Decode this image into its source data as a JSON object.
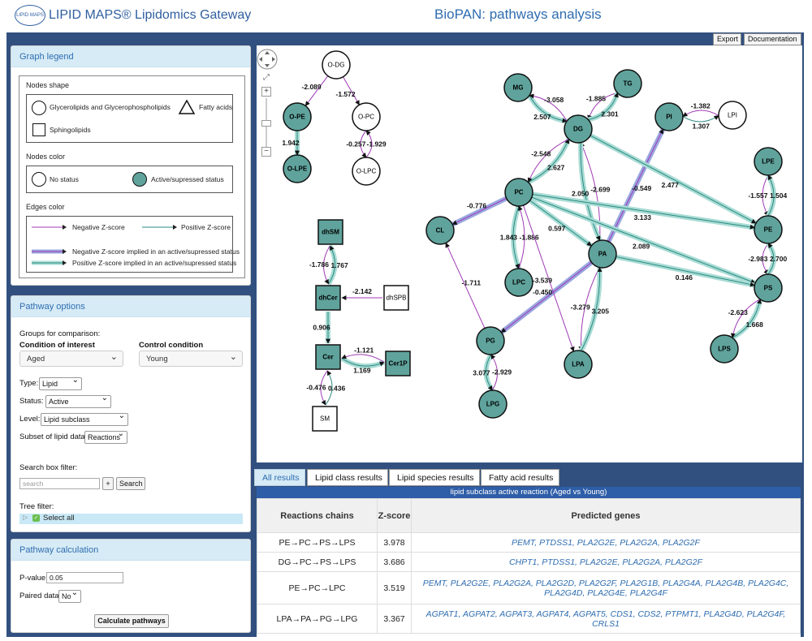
{
  "header": {
    "logo_text": "LIPID MAPS",
    "site_title": "LIPID MAPS® Lipidomics Gateway",
    "app_title": "BioPAN: pathways analysis"
  },
  "toolbar": {
    "export_label": "Export",
    "documentation_label": "Documentation"
  },
  "legend": {
    "title": "Graph legend",
    "shape_title": "Nodes shape",
    "shape_items": [
      "Glycerolipids and Glycerophospholipids",
      "Fatty acids",
      "Sphingolipids"
    ],
    "color_title": "Nodes color",
    "color_items": [
      "No status",
      "Active/supressed status"
    ],
    "edge_title": "Edges color",
    "edge_items": [
      "Negative Z-score",
      "Positive Z-score",
      "Negative Z-score implied in an active/supressed status",
      "Positive Z-score implied in an active/supressed status"
    ]
  },
  "options": {
    "title": "Pathway options",
    "groups_label": "Groups for comparison:",
    "condition_label": "Condition of interest",
    "control_label": "Control condition",
    "condition_value": "Aged",
    "control_value": "Young",
    "type_label": "Type:",
    "type_value": "Lipid",
    "status_label": "Status:",
    "status_value": "Active",
    "level_label": "Level:",
    "level_value": "Lipid subclass",
    "subset_label": "Subset of lipid data:",
    "subset_value": "Reactions",
    "search_label": "Search box filter:",
    "search_placeholder": "search",
    "plus_label": "+",
    "search_button": "Search",
    "tree_label": "Tree filter:",
    "select_all": "Select all"
  },
  "calc": {
    "title": "Pathway calculation",
    "pvalue_label": "P-value:",
    "pvalue_value": "0.05",
    "paired_label": "Paired data:",
    "paired_value": "No",
    "calc_button": "Calculate pathways"
  },
  "graph_controls": {
    "zoom_in": "+",
    "zoom_out": "−",
    "fit": "⤢"
  },
  "graph": {
    "colors": {
      "teal": "#5fa39c",
      "neg": "#a03ab5",
      "pos": "#2a8a80",
      "neg_halo": "#9aa8e0",
      "pos_halo": "#a9dcd5"
    },
    "nodes": [
      {
        "id": "O-DG",
        "shape": "circle",
        "active": false
      },
      {
        "id": "O-PE",
        "shape": "circle",
        "active": true
      },
      {
        "id": "O-PC",
        "shape": "circle",
        "active": false
      },
      {
        "id": "O-LPE",
        "shape": "circle",
        "active": true
      },
      {
        "id": "O-LPC",
        "shape": "circle",
        "active": false
      },
      {
        "id": "MG",
        "shape": "circle",
        "active": true
      },
      {
        "id": "TG",
        "shape": "circle",
        "active": true
      },
      {
        "id": "DG",
        "shape": "circle",
        "active": true
      },
      {
        "id": "PI",
        "shape": "circle",
        "active": true
      },
      {
        "id": "LPI",
        "shape": "circle",
        "active": false
      },
      {
        "id": "LPE",
        "shape": "circle",
        "active": true
      },
      {
        "id": "PC",
        "shape": "circle",
        "active": true
      },
      {
        "id": "CL",
        "shape": "circle",
        "active": true
      },
      {
        "id": "PE",
        "shape": "circle",
        "active": true
      },
      {
        "id": "PA",
        "shape": "circle",
        "active": true
      },
      {
        "id": "PS",
        "shape": "circle",
        "active": true
      },
      {
        "id": "LPC",
        "shape": "circle",
        "active": true
      },
      {
        "id": "LPS",
        "shape": "circle",
        "active": true
      },
      {
        "id": "PG",
        "shape": "circle",
        "active": true
      },
      {
        "id": "LPA",
        "shape": "circle",
        "active": true
      },
      {
        "id": "PGs",
        "label": "PG",
        "shape": "circle",
        "active": true
      },
      {
        "id": "LPG",
        "shape": "circle",
        "active": true
      },
      {
        "id": "dhSM",
        "shape": "square",
        "active": true
      },
      {
        "id": "dhCer",
        "shape": "square",
        "active": true
      },
      {
        "id": "dhSPB",
        "shape": "square",
        "active": false
      },
      {
        "id": "Cer",
        "shape": "square",
        "active": true
      },
      {
        "id": "Cer1P",
        "shape": "square",
        "active": true
      },
      {
        "id": "SM",
        "shape": "square",
        "active": false
      }
    ],
    "edges": [
      {
        "from": "O-DG",
        "to": "O-PE",
        "z": "-2.089",
        "kind": "neg"
      },
      {
        "from": "O-DG",
        "to": "O-PC",
        "z": "-1.572",
        "kind": "neg"
      },
      {
        "from": "O-PE",
        "to": "O-LPE",
        "z": "1.942",
        "kind": "pos_active"
      },
      {
        "from": "O-PC",
        "to": "O-LPC",
        "z": "-0.257",
        "kind": "neg",
        "curve": -1
      },
      {
        "from": "O-LPC",
        "to": "O-PC",
        "z": "-1.929",
        "kind": "neg",
        "curve": -1
      },
      {
        "from": "MG",
        "to": "DG",
        "z": "2.507",
        "kind": "pos_active",
        "curve": -1
      },
      {
        "from": "DG",
        "to": "MG",
        "z": "-3.058",
        "kind": "neg",
        "curve": -1
      },
      {
        "from": "TG",
        "to": "DG",
        "z": "-1.885",
        "kind": "neg",
        "curve": -1
      },
      {
        "from": "DG",
        "to": "TG",
        "z": "2.301",
        "kind": "pos_active",
        "curve": -1
      },
      {
        "from": "PI",
        "to": "LPI",
        "z": "1.307",
        "kind": "pos",
        "curve": -1
      },
      {
        "from": "LPI",
        "to": "PI",
        "z": "-1.382",
        "kind": "neg",
        "curve": -1
      },
      {
        "from": "PC",
        "to": "DG",
        "z": "2.627",
        "kind": "pos_active",
        "curve": -1
      },
      {
        "from": "DG",
        "to": "PC",
        "z": "-2.548",
        "kind": "neg",
        "curve": -1
      },
      {
        "from": "PA",
        "to": "DG",
        "z": "-2.699",
        "kind": "neg",
        "curve": -1
      },
      {
        "from": "DG",
        "to": "PA",
        "z": "2.050",
        "kind": "pos_active",
        "curve": -1
      },
      {
        "from": "PA",
        "to": "PI",
        "z": "-0.549",
        "kind": "neg_active"
      },
      {
        "from": "DG",
        "to": "PE",
        "z": "2.477",
        "kind": "pos_active"
      },
      {
        "from": "LPE",
        "to": "PE",
        "z": "-1.557",
        "kind": "neg",
        "curve": -1
      },
      {
        "from": "PE",
        "to": "LPE",
        "z": "1.504",
        "kind": "pos_active",
        "curve": -1
      },
      {
        "from": "PC",
        "to": "CL",
        "z": "-0.776",
        "kind": "neg_active"
      },
      {
        "from": "PC",
        "to": "PE",
        "z": "3.133",
        "kind": "pos_active"
      },
      {
        "from": "PC",
        "to": "PA",
        "z": "0.597",
        "kind": "pos_active"
      },
      {
        "from": "PC",
        "to": "PS",
        "z": "2.089",
        "kind": "pos_active"
      },
      {
        "from": "PE",
        "to": "PS",
        "z": "-2.983",
        "kind": "neg",
        "curve": -1
      },
      {
        "from": "PS",
        "to": "PE",
        "z": "2.700",
        "kind": "pos_active",
        "curve": -1
      },
      {
        "from": "PA",
        "to": "PS",
        "z": "0.146",
        "kind": "pos_active"
      },
      {
        "from": "PC",
        "to": "LPC",
        "z": "1.843",
        "kind": "pos_active",
        "curve": -1
      },
      {
        "from": "LPC",
        "to": "PC",
        "z": "-1.886",
        "kind": "neg",
        "curve": -1
      },
      {
        "from": "PG",
        "to": "CL",
        "z": "-1.711",
        "kind": "neg"
      },
      {
        "from": "PA",
        "to": "PG",
        "z": "-0.450",
        "kind": "neg_active"
      },
      {
        "from": "PC",
        "to": "LPA",
        "z": "-3.539",
        "kind": "neg"
      },
      {
        "from": "PA",
        "to": "LPA",
        "z": "-3.279",
        "kind": "neg",
        "curve": -1
      },
      {
        "from": "LPA",
        "to": "PA",
        "z": "3.205",
        "kind": "pos_active",
        "curve": -1
      },
      {
        "from": "LPS",
        "to": "PS",
        "z": "1.668",
        "kind": "pos_active",
        "curve": -1
      },
      {
        "from": "PS",
        "to": "LPS",
        "z": "-2.623",
        "kind": "neg",
        "curve": -1
      },
      {
        "from": "PG",
        "to": "LPG",
        "z": "3.077",
        "kind": "pos_active",
        "curve": -1
      },
      {
        "from": "LPG",
        "to": "PG",
        "z": "-2.929",
        "kind": "neg",
        "curve": -1
      },
      {
        "from": "dhCer",
        "to": "dhSM",
        "z": "1.767",
        "kind": "pos_active",
        "curve": -1
      },
      {
        "from": "dhSM",
        "to": "dhCer",
        "z": "-1.786",
        "kind": "neg",
        "curve": -1
      },
      {
        "from": "dhSPB",
        "to": "dhCer",
        "z": "-2.142",
        "kind": "neg"
      },
      {
        "from": "dhCer",
        "to": "Cer",
        "z": "0.906",
        "kind": "pos_active"
      },
      {
        "from": "Cer",
        "to": "Cer1P",
        "z": "1.169",
        "kind": "pos_active",
        "curve": -1
      },
      {
        "from": "Cer1P",
        "to": "Cer",
        "z": "-1.121",
        "kind": "neg",
        "curve": -1
      },
      {
        "from": "SM",
        "to": "Cer",
        "z": "0.436",
        "kind": "pos",
        "curve": -1
      },
      {
        "from": "Cer",
        "to": "SM",
        "z": "-0.476",
        "kind": "neg",
        "curve": -1
      }
    ]
  },
  "results": {
    "tabs": [
      "All results",
      "Lipid class results",
      "Lipid species results",
      "Fatty acid results"
    ],
    "caption": "lipid subclass active reaction (Aged vs Young)",
    "headers": [
      "Reactions chains",
      "Z-score",
      "Predicted genes"
    ],
    "rows": [
      {
        "chain": "PE→PC→PS→LPS",
        "z": "3.978",
        "genes": "PEMT, PTDSS1, PLA2G2E, PLA2G2A, PLA2G2F"
      },
      {
        "chain": "DG→PC→PS→LPS",
        "z": "3.686",
        "genes": "CHPT1, PTDSS1, PLA2G2E, PLA2G2A, PLA2G2F"
      },
      {
        "chain": "PE→PC→LPC",
        "z": "3.519",
        "genes": "PEMT, PLA2G2E, PLA2G2A, PLA2G2D, PLA2G2F, PLA2G1B, PLA2G4A, PLA2G4B, PLA2G4C, PLA2G4D, PLA2G4E, PLA2G4F"
      },
      {
        "chain": "LPA→PA→PG→LPG",
        "z": "3.367",
        "genes": "AGPAT1, AGPAT2, AGPAT3, AGPAT4, AGPAT5, CDS1, CDS2, PTPMT1, PLA2G4D, PLA2G4F, CRLS1"
      }
    ]
  }
}
